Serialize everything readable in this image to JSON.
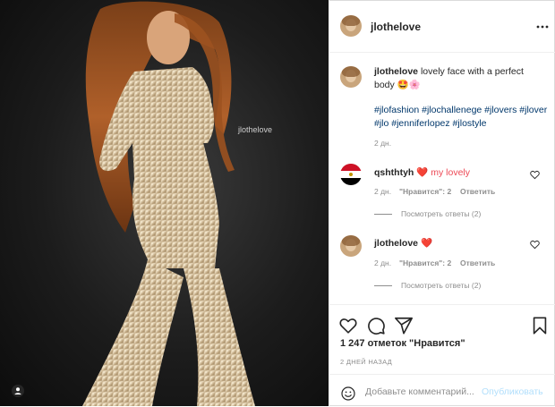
{
  "post": {
    "watermark": "jlothelove"
  },
  "header": {
    "username": "jlothelove",
    "more_icon": "more-horizontal-icon"
  },
  "caption": {
    "username": "jlothelove",
    "text": "lovely face with a perfect body 🤩🌸",
    "hashtags": "#jlofashion #jlochallenege #jlovers #jlover #jlo #jenniferlopez #jlostyle",
    "time": "2 дн."
  },
  "comments": [
    {
      "username": "qshthtyh",
      "text": "❤️ my lovely",
      "time": "2 дн.",
      "likes": "\"Нравится\": 2",
      "reply": "Ответить",
      "view_replies": "Посмотреть ответы (2)"
    },
    {
      "username": "jlothelove",
      "text": "❤️",
      "time": "2 дн.",
      "likes": "\"Нравится\": 2",
      "reply": "Ответить",
      "view_replies": "Посмотреть ответы (2)"
    }
  ],
  "actions": {
    "like_icon": "heart-icon",
    "comment_icon": "comment-icon",
    "share_icon": "send-icon",
    "save_icon": "bookmark-icon"
  },
  "likes_text": "1 247 отметок \"Нравится\"",
  "date_text": "2 ДНЕЙ НАЗАД",
  "add_comment": {
    "placeholder": "Добавьте комментарий...",
    "publish_label": "Опубликовать"
  },
  "colors": {
    "link": "#00376b",
    "muted": "#8e8e8e",
    "publish_disabled": "#b2dffc",
    "heart_red": "#ed4956"
  }
}
